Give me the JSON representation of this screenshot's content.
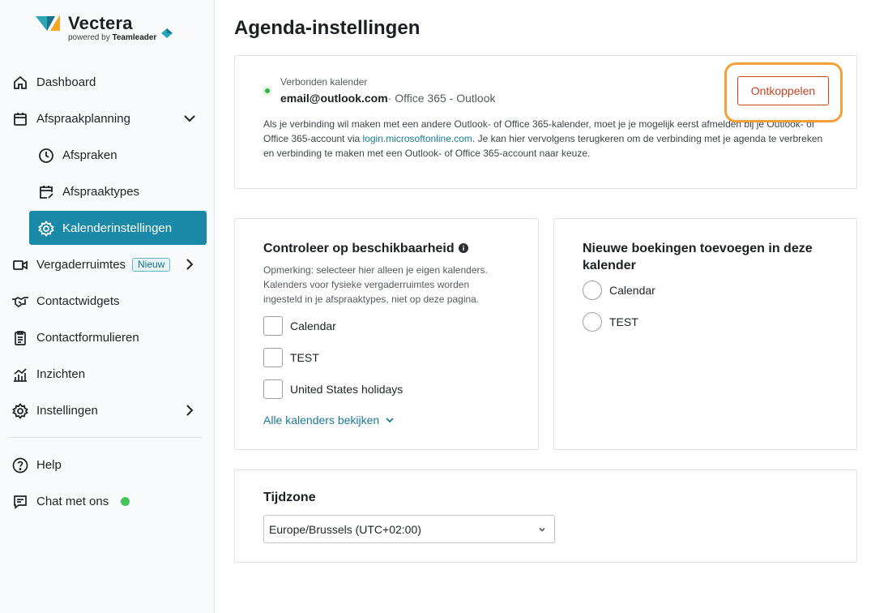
{
  "brand": {
    "name": "Vectera",
    "powered_prefix": "powered by",
    "powered_brand": "Teamleader",
    "colors": {
      "accent": "#1b8aa8",
      "logo_orange": "#f5a623",
      "logo_teal": "#2aa6b8"
    }
  },
  "sidebar": {
    "items": [
      {
        "label": "Dashboard",
        "icon": "home-icon"
      },
      {
        "label": "Afspraakplanning",
        "icon": "calendar-icon",
        "chevron": "chevron-down-icon"
      },
      {
        "label": "Afspraken",
        "icon": "clock-icon"
      },
      {
        "label": "Afspraaktypes",
        "icon": "calendar-edit-icon"
      },
      {
        "label": "Kalenderinstellingen",
        "icon": "gear-icon",
        "active": true
      },
      {
        "label": "Vergaderruimtes",
        "icon": "video-icon",
        "badge": "Nieuw",
        "chevron": "chevron-right-icon"
      },
      {
        "label": "Contactwidgets",
        "icon": "handshake-icon"
      },
      {
        "label": "Contactformulieren",
        "icon": "form-icon"
      },
      {
        "label": "Inzichten",
        "icon": "insights-icon"
      },
      {
        "label": "Instellingen",
        "icon": "gear-icon",
        "chevron": "chevron-right-icon"
      }
    ],
    "footer": [
      {
        "label": "Help",
        "icon": "help-icon"
      },
      {
        "label": "Chat met ons",
        "icon": "chat-icon",
        "status": "online"
      }
    ]
  },
  "main": {
    "title": "Agenda-instellingen",
    "connection": {
      "label": "Verbonden kalender",
      "email": "email@outlook.com",
      "provider": "· Office 365 - Outlook",
      "desc_before": "Als je verbinding wil maken met een andere Outlook- of Office 365-kalender, moet je je mogelijk eerst afmelden bij je Outlook- of Office 365-account via ",
      "desc_link": "login.microsoftonline.com",
      "desc_after": ". Je kan hier vervolgens terugkeren om de verbinding met je agenda te verbreken en verbinding te maken met een Outlook- of Office 365-account naar keuze.",
      "disconnect_label": "Ontkoppelen"
    },
    "availability": {
      "title": "Controleer op beschikbaarheid",
      "note": "Opmerking: selecteer hier alleen je eigen kalenders. Kalenders voor fysieke vergaderruimtes worden ingesteld in je afspraaktypes, niet op deze pagina.",
      "calendars": [
        {
          "label": "Calendar",
          "checked": false
        },
        {
          "label": "TEST",
          "checked": false
        },
        {
          "label": "United States holidays",
          "checked": false
        }
      ],
      "view_all_label": "Alle kalenders bekijken"
    },
    "new_bookings": {
      "title": "Nieuwe boekingen toevoegen in deze kalender",
      "options": [
        {
          "label": "Calendar",
          "selected": false
        },
        {
          "label": "TEST",
          "selected": false
        }
      ]
    },
    "timezone": {
      "title": "Tijdzone",
      "value": "Europe/Brussels (UTC+02:00)"
    }
  }
}
